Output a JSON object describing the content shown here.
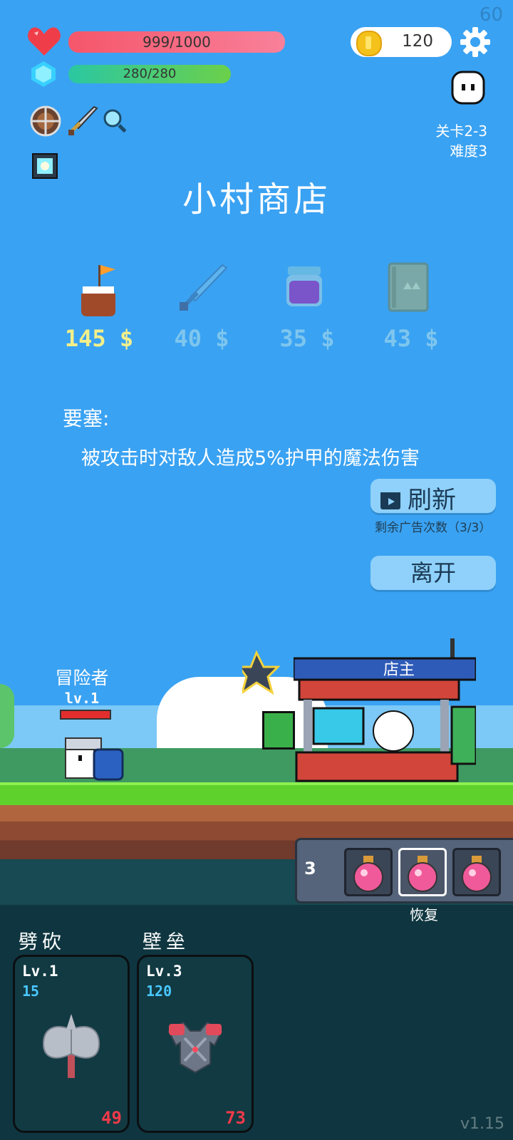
{
  "fps": "60",
  "version": "v1.15",
  "hud": {
    "hp_text": "999/1000",
    "hp_fraction": 0.999,
    "mp_text": "280/280",
    "mp_fraction": 1.0,
    "gold": "120",
    "stage": "关卡2-3",
    "difficulty": "难度3"
  },
  "equipment_icons": [
    "shield-icon",
    "sword-icon",
    "magnifier-icon",
    "lantern-icon"
  ],
  "shop": {
    "title": "小村商店",
    "items": [
      {
        "icon": "flag-pot-icon",
        "price": "145 $",
        "color": "#f3ef8a"
      },
      {
        "icon": "sword-icon",
        "price": "40 $",
        "color": "#7ec6ee"
      },
      {
        "icon": "jar-icon",
        "price": "35 $",
        "color": "#7ec6ee"
      },
      {
        "icon": "book-icon",
        "price": "43 $",
        "color": "#7ec6ee"
      }
    ],
    "desc_title": "要塞:",
    "desc_text": "被攻击时对敌人造成5%护甲的魔法伤害",
    "refresh_label": "刷新",
    "ads_remaining": "剩余广告次数（3/3）",
    "leave_label": "离开"
  },
  "scene": {
    "player_name": "冒险者",
    "player_level": "lv.1",
    "shopkeeper_label": "店主"
  },
  "potions": {
    "count": "3",
    "label": "恢复"
  },
  "skills": [
    {
      "name": "劈砍",
      "level": "Lv.1",
      "value": "15",
      "cost": "49",
      "icon": "axe-icon"
    },
    {
      "name": "壁垒",
      "level": "Lv.3",
      "value": "120",
      "cost": "73",
      "icon": "armor-icon"
    }
  ],
  "colors": {
    "sky": "#3aa2f2",
    "hp": "#f5566a",
    "mp": "#2bc7a2",
    "price_active": "#f3ef8a",
    "price_inactive": "#7ec6ee"
  }
}
